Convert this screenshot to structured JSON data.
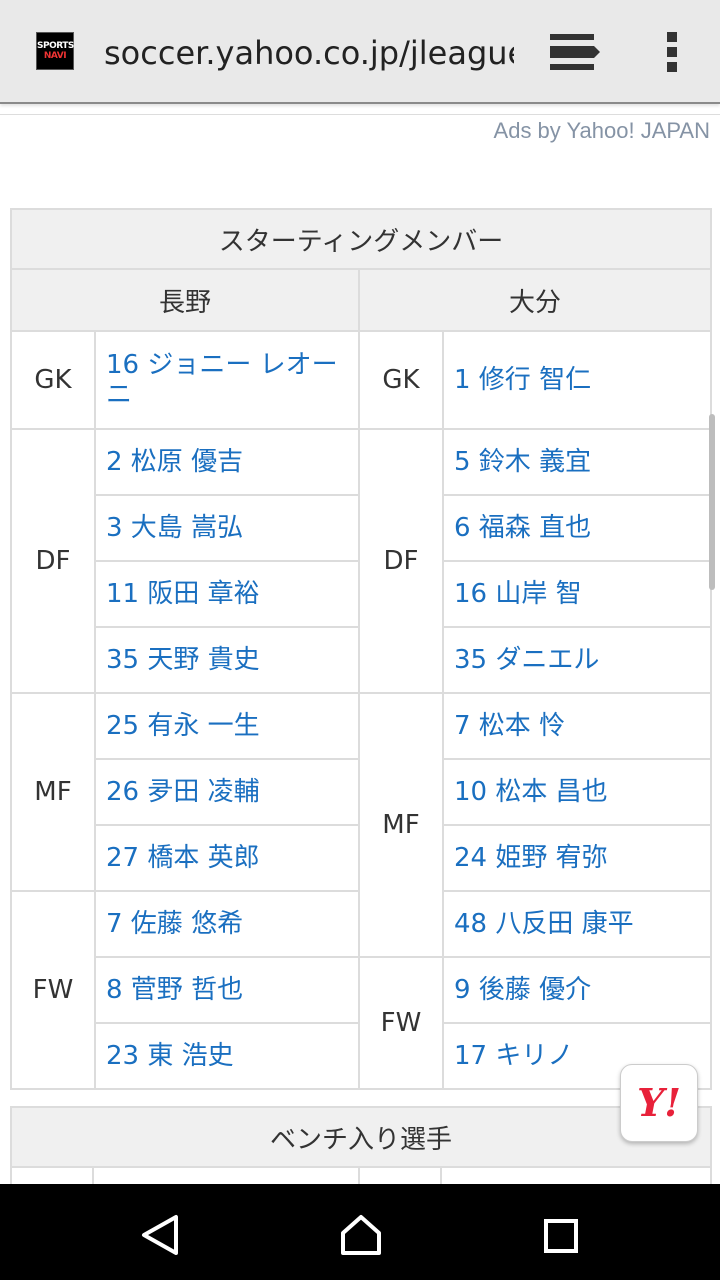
{
  "browser": {
    "url": "soccer.yahoo.co.jp/jleague",
    "favicon_text": "SPORTS NAVI"
  },
  "ads_label": "Ads by Yahoo! JAPAN",
  "lineup": {
    "title": "スターティングメンバー",
    "home_team": "長野",
    "away_team": "大分",
    "home": {
      "gk_label": "GK",
      "gk": [
        "16 ジョニー レオーニ"
      ],
      "df_label": "DF",
      "df": [
        "2 松原 優吉",
        "3 大島 嵩弘",
        "11 阪田 章裕",
        "35 天野 貴史"
      ],
      "mf_label": "MF",
      "mf": [
        "25 有永 一生",
        "26 夛田 凌輔",
        "27 橋本 英郎"
      ],
      "fw_label": "FW",
      "fw": [
        "7 佐藤 悠希",
        "8 菅野 哲也",
        "23 東 浩史"
      ]
    },
    "away": {
      "gk_label": "GK",
      "gk": [
        "1 修行 智仁"
      ],
      "df_label": "DF",
      "df": [
        "5 鈴木 義宜",
        "6 福森 直也",
        "16 山岸 智",
        "35 ダニエル"
      ],
      "mf_label": "MF",
      "mf": [
        "7 松本 怜",
        "10 松本 昌也",
        "24 姫野 宥弥",
        "48 八反田 康平"
      ],
      "fw_label": "FW",
      "fw": [
        "9 後藤 優介",
        "17 キリノ"
      ]
    }
  },
  "bench": {
    "title": "ベンチ入り選手"
  },
  "floating_button": {
    "label": "Y!"
  }
}
